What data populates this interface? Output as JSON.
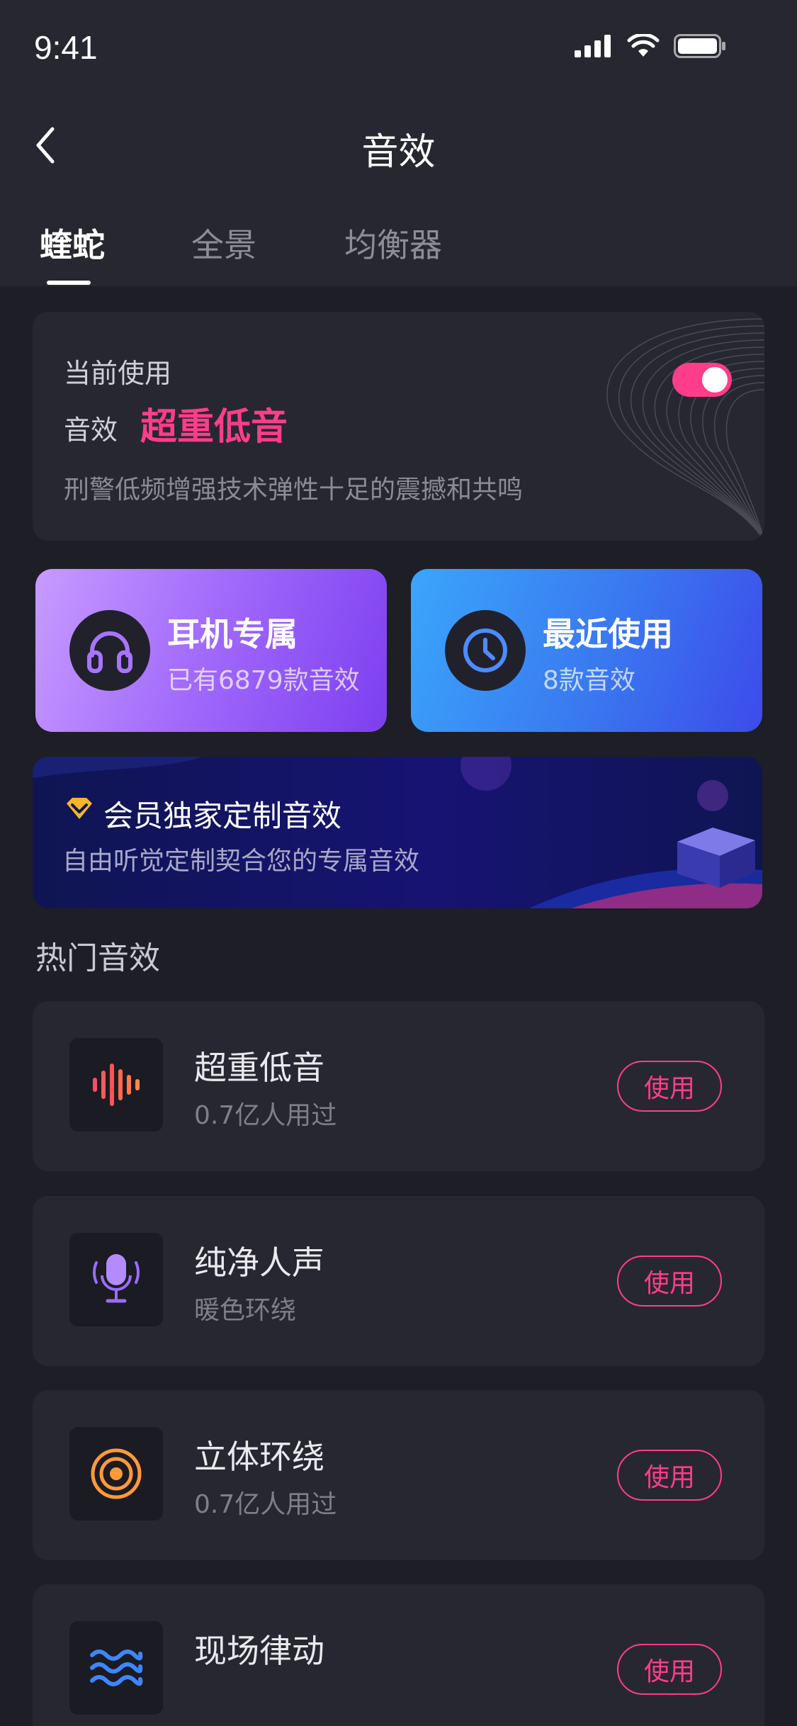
{
  "status": {
    "time": "9:41"
  },
  "nav": {
    "title": "音效"
  },
  "tabs": [
    {
      "label": "蝰蛇",
      "active": true
    },
    {
      "label": "全景",
      "active": false
    },
    {
      "label": "均衡器",
      "active": false
    }
  ],
  "current": {
    "label": "当前使用",
    "effect_label": "音效",
    "effect_name": "超重低音",
    "description": "刑警低频增强技术弹性十足的震撼和共鸣",
    "enabled": true
  },
  "cards": [
    {
      "title": "耳机专属",
      "subtitle": "已有6879款音效",
      "icon": "headphones-icon"
    },
    {
      "title": "最近使用",
      "subtitle": "8款音效",
      "icon": "clock-icon"
    }
  ],
  "vip": {
    "title": "会员独家定制音效",
    "subtitle": "自由听觉定制契合您的专属音效"
  },
  "hot": {
    "title": "热门音效",
    "items": [
      {
        "title": "超重低音",
        "subtitle": "0.7亿人用过",
        "button": "使用",
        "icon": "soundwave-icon"
      },
      {
        "title": "纯净人声",
        "subtitle": "暖色环绕",
        "button": "使用",
        "icon": "microphone-icon"
      },
      {
        "title": "立体环绕",
        "subtitle": "0.7亿人用过",
        "button": "使用",
        "icon": "surround-icon"
      },
      {
        "title": "现场律动",
        "subtitle": "",
        "button": "使用",
        "icon": "wave-icon"
      }
    ]
  },
  "colors": {
    "accent": "#ff3d8b",
    "background": "#1e1e26",
    "card": "#272731"
  }
}
